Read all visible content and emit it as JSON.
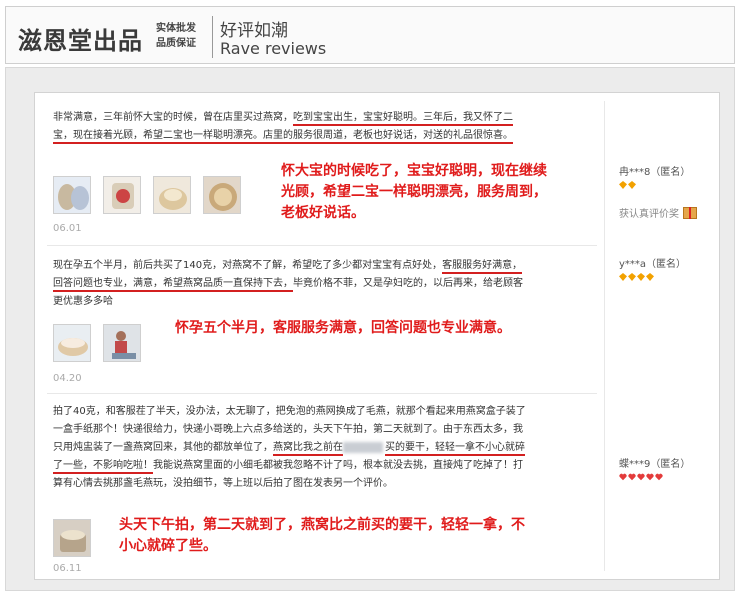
{
  "header": {
    "brand": "滋恩堂出品",
    "tagline_1": "实体批发",
    "tagline_2": "品质保证",
    "title": "好评如潮",
    "subtitle": "Rave reviews"
  },
  "reviews": [
    {
      "text_a": "非常满意，三年前怀大宝的时候，曾在店里买过燕窝，",
      "text_b": "吃到宝宝出生，宝宝好聪明。三年后，我又怀了二宝，现在接着光顾，希望二宝也一样聪明漂亮。",
      "text_c": "店里的服务很周道，老板也好说话，对送的礼品很惊喜。",
      "note": "怀大宝的时候吃了，宝宝好聪明，现在继续光顾，希望二宝一样聪明漂亮，服务周到，老板好说话。",
      "date": "06.01",
      "user": "冉***8（匿名）",
      "gift_label": "获认真评价奖",
      "stars": 2
    },
    {
      "text_a": "现在孕五个半月，前后共买了140克，对燕窝不了解，希望吃了多少都对宝宝有点好处，",
      "text_b": "客服服务好满意，回答问题也专业，满意，希望燕窝品质一直保持下去，",
      "text_c": "毕竟价格不菲，又是孕妇吃的，以后再来，给老顾客更优惠多多哈",
      "note": "怀孕五个半月，客服服务满意，回答问题也专业满意。",
      "date": "04.20",
      "user": "y***a（匿名）",
      "stars": 4
    },
    {
      "text_a": "拍了40克，和客服茬了半天，没办法，太无聊了，把免泡的燕网换成了毛燕，就那个看起来用燕窝盒子装了一盒手纸那个！快递很给力，快递小哥晚上六点多给送的，头天下午拍，第二天就到了。由于东西太多，我只用炖盅装了一盏燕窝回来，其他的都放单位了，",
      "text_b": "燕窝比我之前在",
      "text_b2": "买的要干，轻轻一拿不小心就碎了一些，不影响吃啦！",
      "text_c": "我能说燕窝里面的小细毛都被我忽略不计了吗，根本就没去挑，直接炖了吃掉了！打算有心情去挑那盏毛燕玩，没拍细节，等上班以后拍了图在发表另一个评价。",
      "note": "头天下午拍，第二天就到了，燕窝比之前买的要干，轻轻一拿，不小心就碎了些。",
      "date": "06.11",
      "user": "蝶***9（匿名）",
      "stars": 5
    }
  ],
  "colors": {
    "accent_red": "#e01b1b",
    "underline_red": "#d32020",
    "gem_orange": "#f2a100",
    "gem_red": "#e33b3b"
  }
}
